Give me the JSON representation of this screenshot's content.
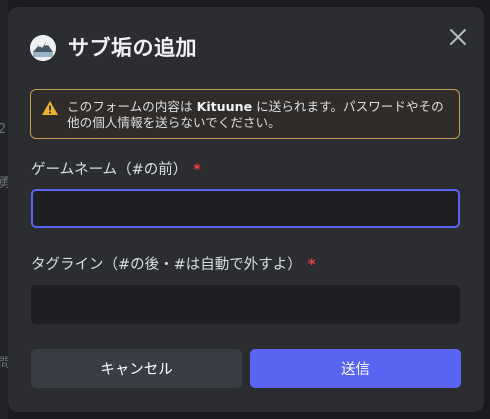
{
  "backdrop": {
    "edge_glyphs": [
      "2",
      "勇",
      "問"
    ]
  },
  "dialog": {
    "title": "サブ垢の追加",
    "avatar_icon": "snowy-mountain-avatar-icon",
    "close_icon": "close-icon"
  },
  "warning": {
    "icon": "warning-triangle-icon",
    "text_before": "このフォームの内容は ",
    "bold": "Kituune",
    "text_after": " に送られます。パスワードやその他の個人情報を送らないでください。",
    "border_color": "#c59b4b"
  },
  "fields": {
    "game_name": {
      "label": "ゲームネーム（#の前）",
      "required_mark": "*",
      "value": "",
      "placeholder": ""
    },
    "tagline": {
      "label": "タグライン（#の後・#は自動で外すよ）",
      "required_mark": "*",
      "value": "",
      "placeholder": ""
    }
  },
  "buttons": {
    "cancel_label": "キャンセル",
    "submit_label": "送信"
  },
  "colors": {
    "accent": "#5865f2",
    "required": "#f23f43",
    "surface": "#2b2d31",
    "input": "#1e1f22"
  }
}
